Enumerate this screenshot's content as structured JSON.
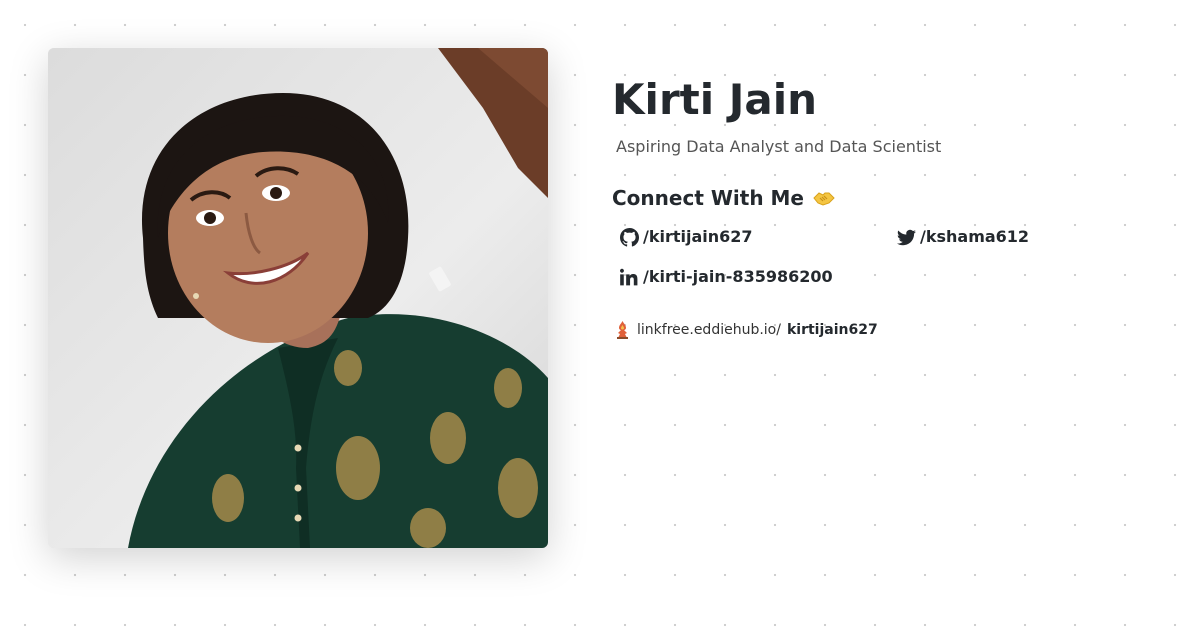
{
  "profile": {
    "name": "Kirti Jain",
    "tagline": "Aspiring Data Analyst and Data Scientist",
    "photo_alt": "profile-photo"
  },
  "connect": {
    "heading": "Connect With Me",
    "emoji": "handshake-icon"
  },
  "socials": [
    {
      "icon": "github-icon",
      "handle": "/kirtijain627"
    },
    {
      "icon": "twitter-icon",
      "handle": "/kshama612"
    },
    {
      "icon": "linkedin-icon",
      "handle": "/kirti-jain-835986200"
    }
  ],
  "linkfree": {
    "icon": "linkfree-logo-icon",
    "domain": "linkfree.eddiehub.io/",
    "username": "kirtijain627"
  },
  "colors": {
    "text_dark": "#24292e",
    "text_muted": "#555555",
    "dress_green": "#163d30",
    "dress_gold": "#a58a4a",
    "hair": "#1c1512",
    "skin": "#b47d5e",
    "background_wall": "#e4e4e4",
    "door_brown": "#6b3d28"
  }
}
